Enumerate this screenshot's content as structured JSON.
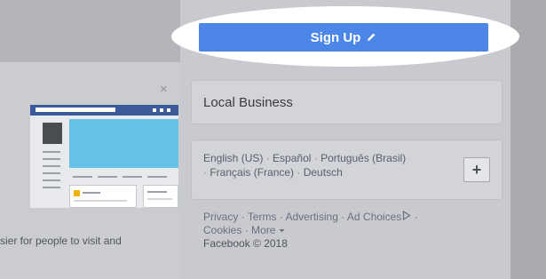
{
  "header": {
    "signup_label": "Sign Up",
    "signup_icon": "pencil-icon"
  },
  "sidebar": {
    "local_business": "Local Business",
    "languages": {
      "items": [
        "English (US)",
        "Español",
        "Português (Brasil)",
        "Français (France)",
        "Deutsch"
      ],
      "separator": "·",
      "more_label": "+"
    },
    "footer": {
      "privacy": "Privacy",
      "terms": "Terms",
      "advertising": "Advertising",
      "ad_choices": "Ad Choices",
      "cookies": "Cookies",
      "more": "More",
      "copyright": "Facebook © 2018"
    }
  },
  "main": {
    "partial_text": "sier for people to visit and",
    "close_label": "×"
  },
  "colors": {
    "signup_button": "#4c87e8",
    "highlight": "#ffffff"
  }
}
